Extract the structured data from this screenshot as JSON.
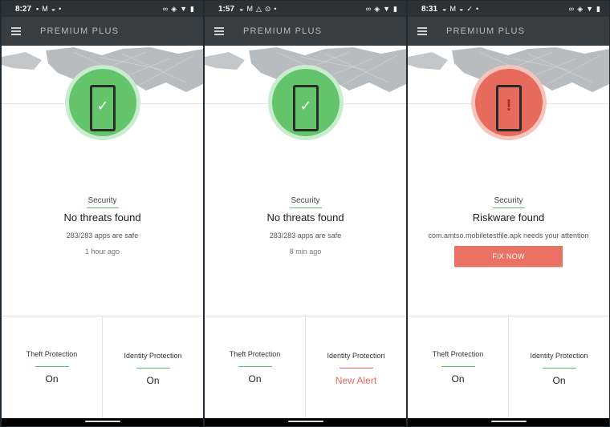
{
  "app": {
    "title": "PREMIUM PLUS"
  },
  "colors": {
    "ok": "#63c46c",
    "ok_ring": "#c9ecce",
    "alert": "#e66b5c",
    "alert_ring": "#f6c3bd",
    "alert_text": "#e06b5e"
  },
  "screens": [
    {
      "status_time": "8:27",
      "state": "ok",
      "icon": "check-icon",
      "security_label": "Security",
      "headline": "No threats found",
      "subtext": "283/283 apps are safe",
      "time_ago": "1 hour ago",
      "theft": {
        "label": "Theft Protection",
        "value": "On"
      },
      "identity": {
        "label": "Identity Protection",
        "value": "On"
      }
    },
    {
      "status_time": "1:57",
      "state": "ok",
      "icon": "check-icon",
      "security_label": "Security",
      "headline": "No threats found",
      "subtext": "283/283 apps are safe",
      "time_ago": "8 min ago",
      "theft": {
        "label": "Theft Protection",
        "value": "On"
      },
      "identity": {
        "label": "Identity Protection",
        "value": "New Alert"
      }
    },
    {
      "status_time": "8:31",
      "state": "alert",
      "icon": "exclamation-icon",
      "security_label": "Security",
      "headline": "Riskware found",
      "subtext": "com.amtso.mobiletestfile.apk needs your attention",
      "button_label": "FIX NOW",
      "theft": {
        "label": "Theft Protection",
        "value": "On"
      },
      "identity": {
        "label": "Identity Protection",
        "value": "On"
      }
    }
  ]
}
